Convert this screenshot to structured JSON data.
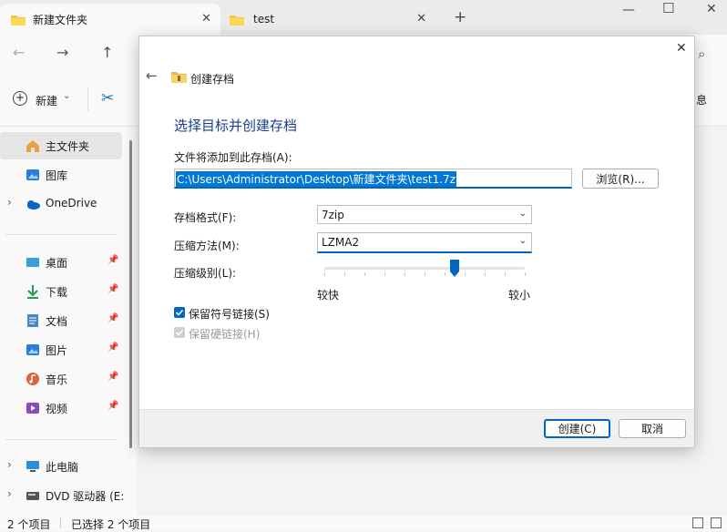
{
  "tabs": [
    {
      "label": "新建文件夹"
    },
    {
      "label": "test"
    }
  ],
  "tab_new": "+",
  "window_controls": {
    "minimize": "—",
    "maximize": "☐",
    "close": "✕"
  },
  "nav": {
    "back": "←",
    "forward": "→",
    "up": "↑",
    "search_icon": "⌕"
  },
  "command_bar": {
    "new_label": "新建",
    "new_chevron": "⌄",
    "cut_icon": "✂",
    "right_fragment": "息"
  },
  "sidebar": {
    "items": [
      {
        "label": "主文件夹",
        "icon": "home-icon"
      },
      {
        "label": "图库",
        "icon": "gallery-icon"
      },
      {
        "label": "OneDrive",
        "icon": "cloud-icon",
        "chevron": "›"
      },
      {
        "label": "桌面",
        "icon": "desktop-icon"
      },
      {
        "label": "下载",
        "icon": "download-icon"
      },
      {
        "label": "文档",
        "icon": "document-icon"
      },
      {
        "label": "图片",
        "icon": "pictures-icon"
      },
      {
        "label": "音乐",
        "icon": "music-icon"
      },
      {
        "label": "视频",
        "icon": "video-icon"
      },
      {
        "label": "此电脑",
        "icon": "pc-icon",
        "chevron": "›"
      },
      {
        "label": "DVD 驱动器 (E:",
        "icon": "dvd-icon",
        "chevron": "›"
      }
    ],
    "pin": "📌"
  },
  "status": {
    "count": "2 个项目",
    "selected": "已选择 2 个项目"
  },
  "dialog": {
    "close": "✕",
    "back": "←",
    "title": "创建存档",
    "heading": "选择目标并创建存档",
    "path_label": "文件将添加到此存档(A):",
    "path_value": "C:\\Users\\Administrator\\Desktop\\新建文件夹\\test1.7z",
    "browse": "浏览(R)...",
    "format_label": "存档格式(F):",
    "format_value": "7zip",
    "method_label": "压缩方法(M):",
    "method_value": "LZMA2",
    "level_label": "压缩级别(L):",
    "level_fraction": 0.65,
    "level_min": "较快",
    "level_max": "较小",
    "symlinks_label": "保留符号链接(S)",
    "symlinks_checked": true,
    "hardlinks_label": "保留硬链接(H)",
    "hardlinks_checked": true,
    "create": "创建(C)",
    "cancel": "取消",
    "colors": {
      "accent": "#0067c0",
      "heading": "#003399",
      "selection": "#0078d7"
    }
  }
}
